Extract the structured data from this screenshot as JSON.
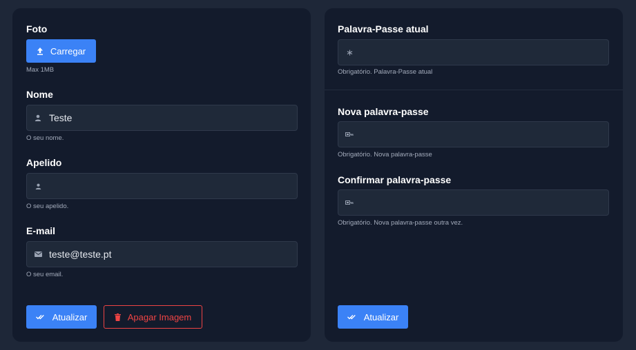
{
  "profile": {
    "photo": {
      "label": "Foto",
      "upload_button": "Carregar",
      "upload_icon": "upload-icon",
      "hint": "Max 1MB"
    },
    "name": {
      "label": "Nome",
      "value": "Teste",
      "icon": "user-icon",
      "hint": "O seu nome."
    },
    "surname": {
      "label": "Apelido",
      "value": "",
      "icon": "user-icon",
      "hint": "O seu apelido."
    },
    "email": {
      "label": "E-mail",
      "value": "teste@teste.pt",
      "icon": "envelope-icon",
      "hint": "O seu email."
    },
    "update_button": "Atualizar",
    "delete_image_button": "Apagar Imagem"
  },
  "password": {
    "current": {
      "label": "Palavra-Passe atual",
      "value": "",
      "icon": "asterisk-icon",
      "hint": "Obrigatório. Palavra-Passe atual"
    },
    "new": {
      "label": "Nova palavra-passe",
      "value": "",
      "icon": "key-icon",
      "hint": "Obrigatório. Nova palavra-passe"
    },
    "confirm": {
      "label": "Confirmar palavra-passe",
      "value": "",
      "icon": "key-icon",
      "hint": "Obrigatório. Nova palavra-passe outra vez."
    },
    "update_button": "Atualizar"
  },
  "colors": {
    "page_bg": "#1e2738",
    "card_bg": "#131b2c",
    "field_bg": "#1f2939",
    "accent": "#3b82f6",
    "danger": "#ef4444"
  }
}
